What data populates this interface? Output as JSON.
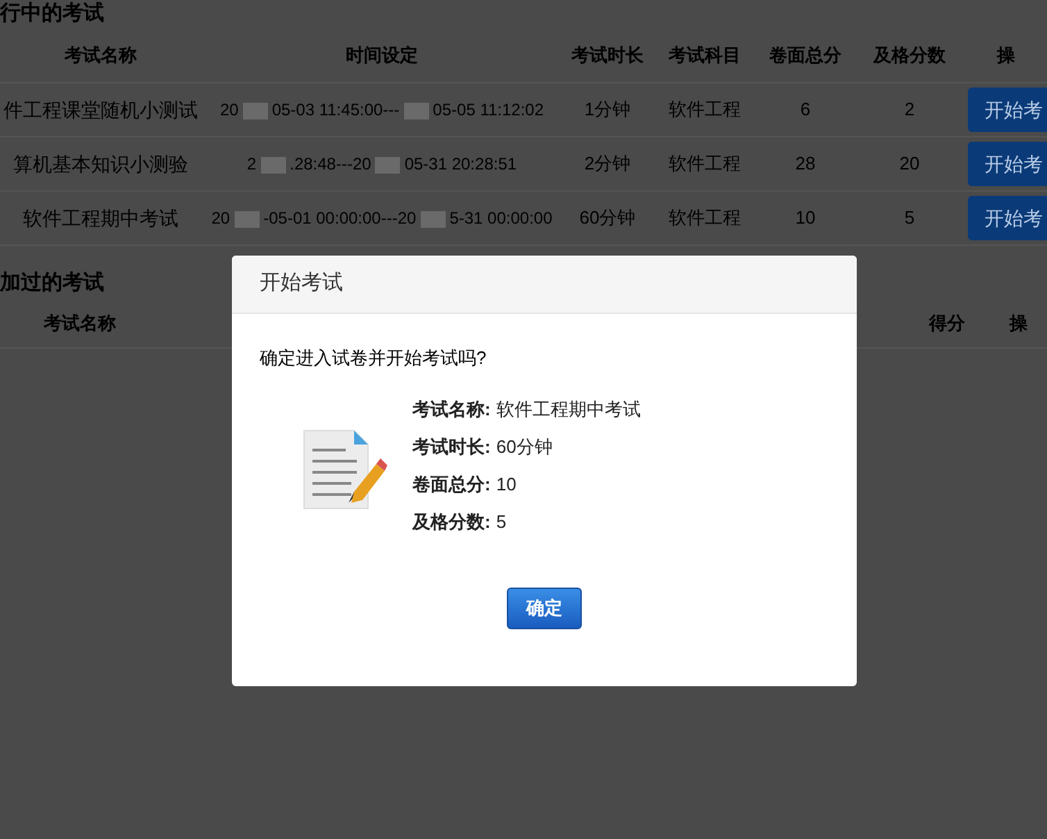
{
  "ongoing_section": {
    "title": "行中的考试",
    "columns": [
      "考试名称",
      "时间设定",
      "考试时长",
      "考试科目",
      "卷面总分",
      "及格分数",
      "操"
    ],
    "rows": [
      {
        "name": "件工程课堂随机小测试",
        "time": [
          "20",
          "05-03 11:45:00---",
          "05-05 11:12:02"
        ],
        "duration": "1分钟",
        "subject": "软件工程",
        "total": "6",
        "pass": "2",
        "action": "开始考"
      },
      {
        "name": "算机基本知识小测验",
        "time": [
          "2",
          ".28:48---20",
          "05-31 20:28:51"
        ],
        "duration": "2分钟",
        "subject": "软件工程",
        "total": "28",
        "pass": "20",
        "action": "开始考"
      },
      {
        "name": "软件工程期中考试",
        "time": [
          "20",
          "-05-01 00:00:00---20",
          "5-31 00:00:00"
        ],
        "duration": "60分钟",
        "subject": "软件工程",
        "total": "10",
        "pass": "5",
        "action": "开始考"
      }
    ]
  },
  "taken_section": {
    "title": "加过的考试",
    "columns": [
      "考试名称",
      "得分",
      "操"
    ]
  },
  "dialog": {
    "title": "开始考试",
    "question": "确定进入试卷并开始考试吗?",
    "details": [
      {
        "label": "考试名称:",
        "value": "软件工程期中考试"
      },
      {
        "label": "考试时长:",
        "value": "60分钟"
      },
      {
        "label": "卷面总分:",
        "value": "10"
      },
      {
        "label": "及格分数:",
        "value": "5"
      }
    ],
    "confirm": "确定"
  }
}
